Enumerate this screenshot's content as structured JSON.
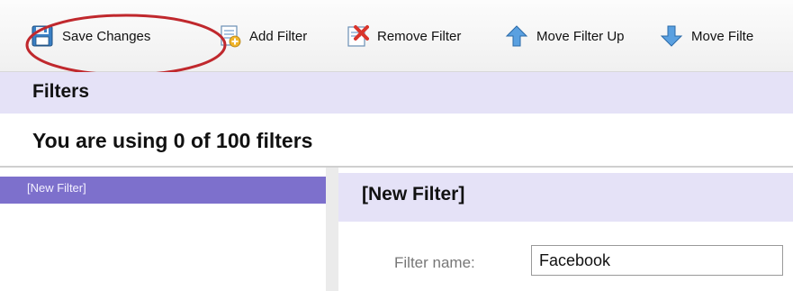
{
  "toolbar": {
    "buttons": [
      {
        "label": "Save Changes",
        "icon": "save-icon"
      },
      {
        "label": "Add Filter",
        "icon": "add-filter-icon"
      },
      {
        "label": "Remove Filter",
        "icon": "remove-filter-icon"
      },
      {
        "label": "Move Filter Up",
        "icon": "arrow-up-icon"
      },
      {
        "label": "Move Filte",
        "icon": "arrow-down-icon"
      }
    ]
  },
  "filters": {
    "title": "Filters",
    "usage_text": "You are using 0 of 100 filters",
    "list": [
      {
        "label": "[New Filter]",
        "selected": true
      }
    ]
  },
  "detail": {
    "title": "[New Filter]",
    "name_label": "Filter name:",
    "name_value": "Facebook"
  },
  "colors": {
    "header_band": "#e5e2f7",
    "selected_item": "#7d70cc",
    "highlight_ellipse": "#c0282d"
  }
}
